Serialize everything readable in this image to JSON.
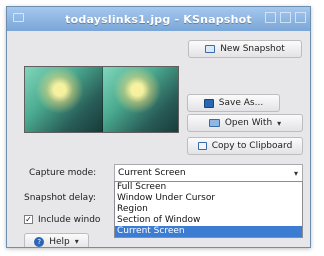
{
  "window": {
    "title": "todayslinks1.jpg - KSnapshot"
  },
  "buttons": {
    "new_snapshot": "New Snapshot",
    "save_as": "Save As...",
    "open_with": "Open With",
    "copy_clipboard": "Copy to Clipboard",
    "help": "Help"
  },
  "labels": {
    "capture_mode": "Capture mode:",
    "snapshot_delay": "Snapshot delay:",
    "include_window": "Include windo"
  },
  "capture_mode": {
    "selected": "Current Screen",
    "options": [
      "Full Screen",
      "Window Under Cursor",
      "Region",
      "Section of Window",
      "Current Screen"
    ]
  },
  "colors": {
    "titlebar": "#7aa6d7",
    "selection": "#3d7cd3"
  },
  "icons": {
    "new_snapshot": "camera-icon",
    "save_as": "save-icon",
    "open_with": "open-with-icon",
    "copy_clipboard": "clipboard-icon",
    "help": "help-icon"
  }
}
